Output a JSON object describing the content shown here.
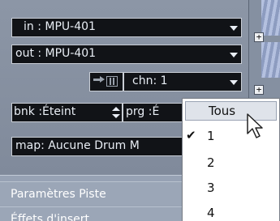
{
  "inspector": {
    "in_field": "in :  MPU-401",
    "out_field": "out :  MPU-401",
    "chn_field": "chn:  1",
    "bnk_field": "bnk :Éteint",
    "prg_field": "prg :É",
    "map_field": "map:  Aucune Drum M",
    "section_parametres": "Paramètres Piste",
    "section_next": "Éffets d'insert"
  },
  "channel_menu": {
    "items": [
      {
        "label": "Tous",
        "checked": false,
        "highlighted": true
      },
      {
        "label": "1",
        "checked": true,
        "highlighted": false
      },
      {
        "label": "2",
        "checked": false,
        "highlighted": false
      },
      {
        "label": "3",
        "checked": false,
        "highlighted": false
      },
      {
        "label": "4",
        "checked": false,
        "highlighted": false
      }
    ]
  },
  "icons": {
    "check": "✔",
    "plus": "+"
  },
  "colors": {
    "field_bg": "#111317",
    "panel_bg": "#8c96a6",
    "menu_highlight": "#dfe3ea"
  }
}
